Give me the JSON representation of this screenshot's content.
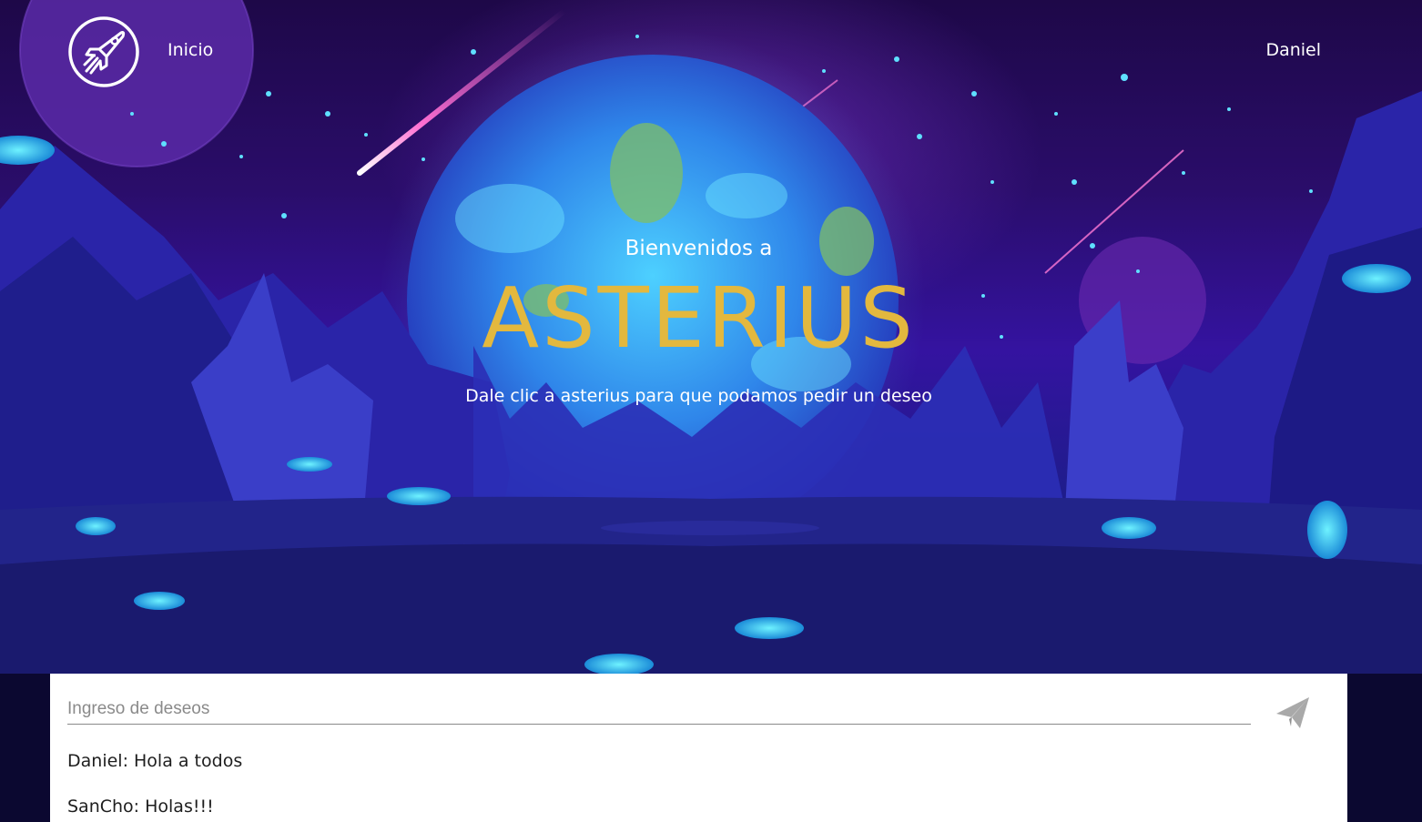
{
  "nav": {
    "logo_icon": "rocket-icon",
    "home_label": "Inicio",
    "user_label": "Daniel"
  },
  "hero": {
    "welcome": "Bienvenidos a",
    "brand": "ASTERIUS",
    "tagline": "Dale clic a asterius para que podamos pedir un deseo"
  },
  "wishes": {
    "placeholder": "Ingreso de deseos",
    "value": "",
    "send_icon": "send-icon",
    "messages": [
      "Daniel: Hola a todos",
      "SanCho: Holas!!!"
    ]
  },
  "colors": {
    "brand": "#e3b83e",
    "hero_top": "#1e0848",
    "planet": "#2fa3f0",
    "panel": "#ffffff"
  }
}
